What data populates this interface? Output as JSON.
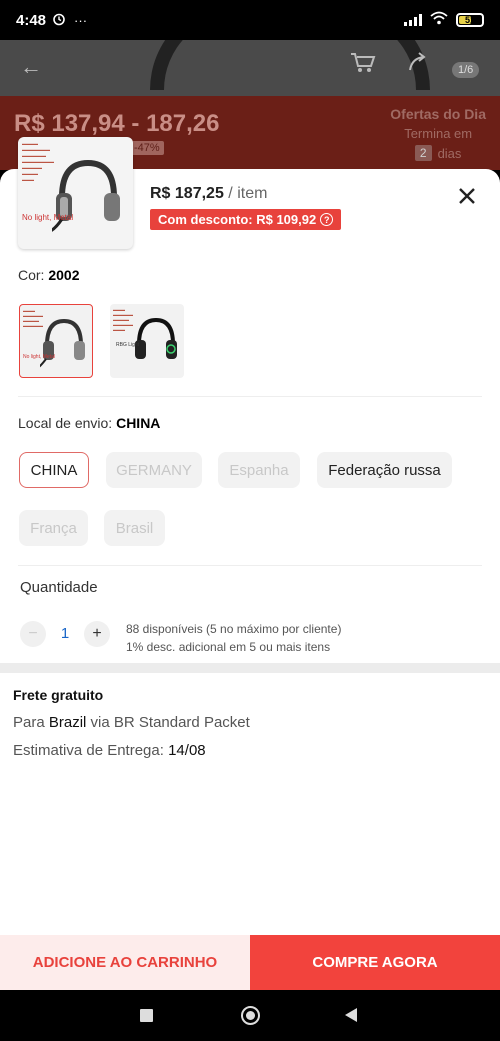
{
  "status_bar": {
    "time": "4:48",
    "alarm_icon": "alarm-icon",
    "more": "···",
    "battery_level": "51"
  },
  "background": {
    "price_range": "R$ 137,94 - 187,26",
    "discount_badge": "-47%",
    "offers_title": "Ofertas do Dia",
    "offers_ends": "Termina em",
    "offers_days_count": "2",
    "offers_days_label": "dias",
    "image_counter": "1/6"
  },
  "sheet": {
    "thumbnail_caption": "No light, Metal",
    "price": "R$ 187,25",
    "price_unit": "/ item",
    "discount_label": "Com desconto: R$ 109,92",
    "color_label": "Cor:",
    "color_value": "2002",
    "variants": [
      {
        "caption": "No light, Metal",
        "selected": true
      },
      {
        "caption": "RBG Light",
        "selected": false
      }
    ],
    "ship_from_label": "Local de envio:",
    "ship_from_value": "CHINA",
    "ship_options": [
      "CHINA",
      "GERMANY",
      "Espanha",
      "Federação russa",
      "França",
      "Brasil"
    ],
    "quantity_label": "Quantidade",
    "quantity_value": "1",
    "quantity_minus": "−",
    "quantity_plus": "+",
    "stock_info": "88 disponíveis (5 no máximo por cliente)",
    "bulk_info": "1% desc. adicional em 5 ou mais itens",
    "shipping_title": "Frete gratuito",
    "shipping_to_prefix": "Para",
    "shipping_to_country": "Brazil",
    "shipping_to_suffix": "via BR Standard Packet",
    "delivery_label": "Estimativa de Entrega:",
    "delivery_date": "14/08"
  },
  "actions": {
    "add_to_cart": "ADICIONE AO CARRINHO",
    "buy_now": "COMPRE AGORA"
  },
  "colors": {
    "accent": "#f2433d",
    "accent_light": "#fdeceb",
    "link_blue": "#1a66c8"
  }
}
